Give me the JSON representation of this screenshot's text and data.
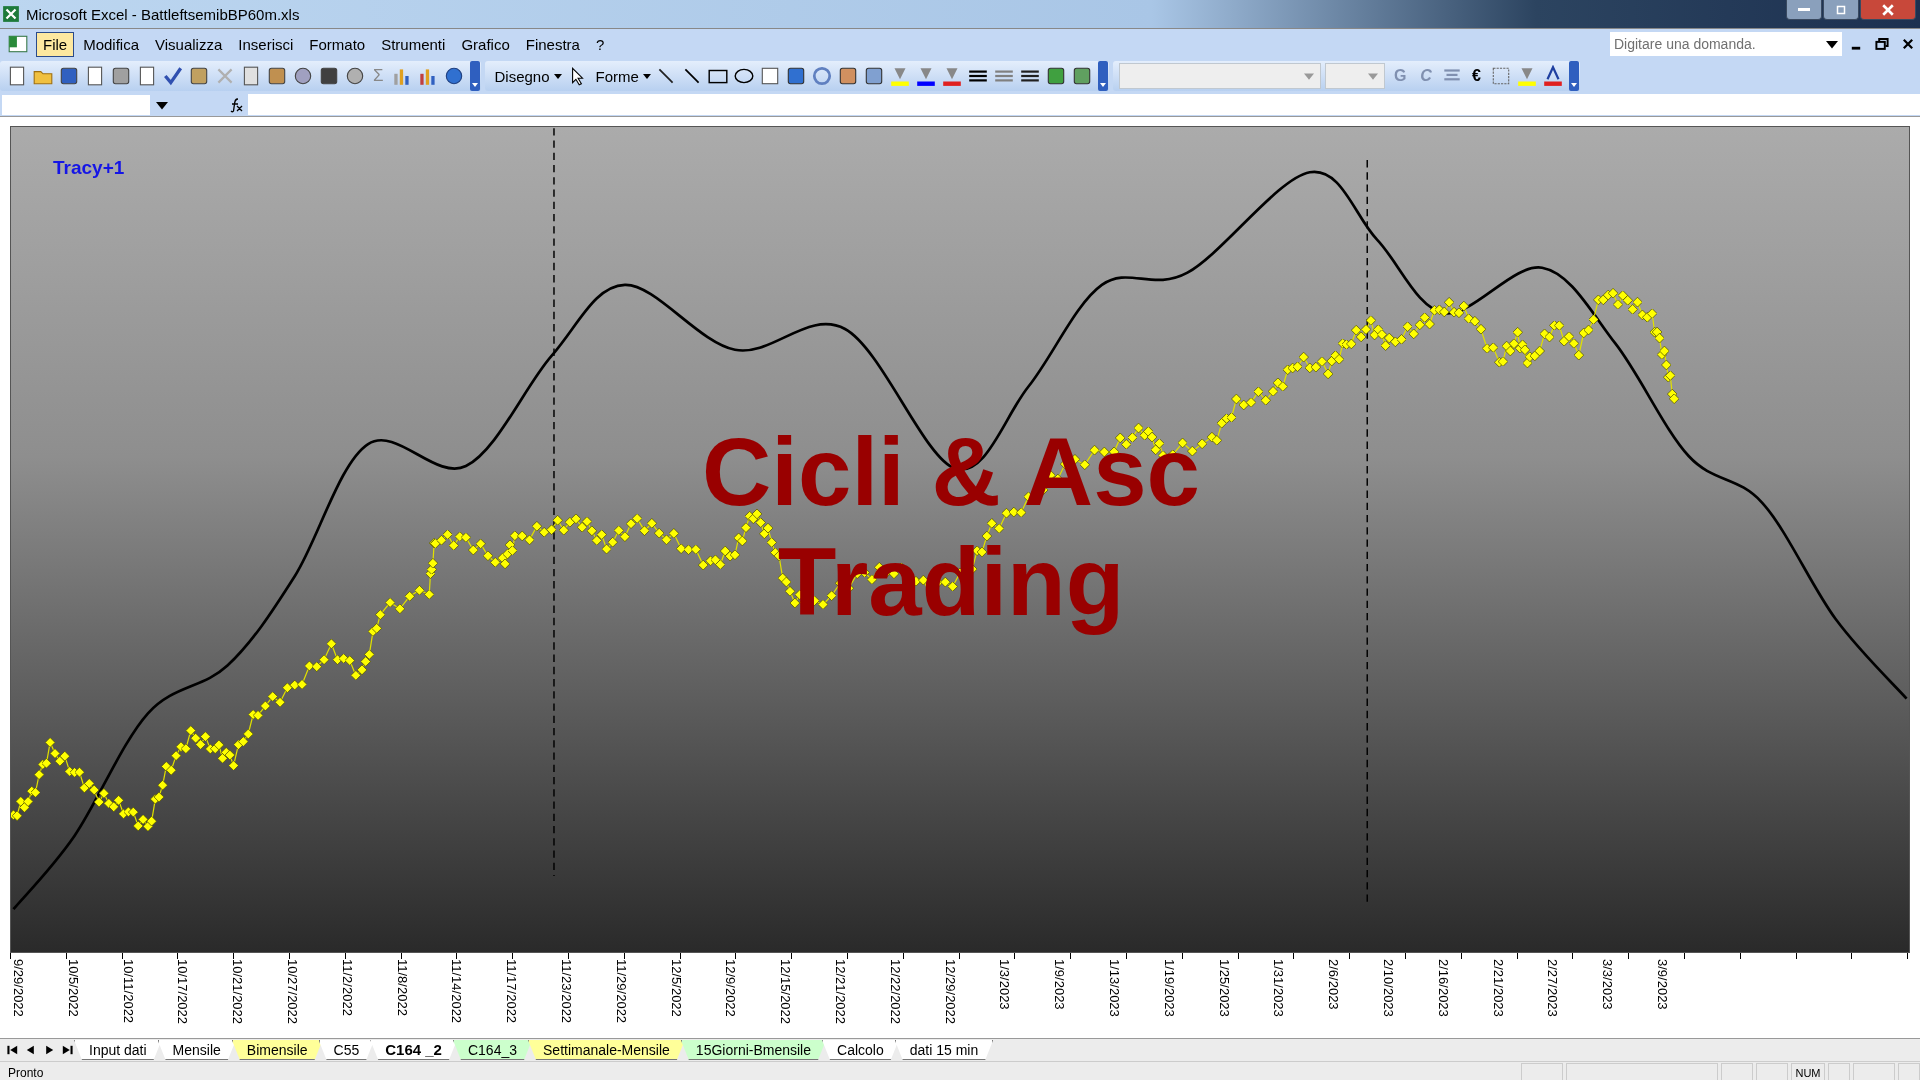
{
  "window": {
    "title": "Microsoft Excel - BattleftsemibBP60m.xls"
  },
  "menu": [
    {
      "label": "File",
      "selected": true
    },
    {
      "label": "Modifica",
      "selected": false
    },
    {
      "label": "Visualizza",
      "selected": false
    },
    {
      "label": "Inserisci",
      "selected": false
    },
    {
      "label": "Formato",
      "selected": false
    },
    {
      "label": "Strumenti",
      "selected": false
    },
    {
      "label": "Grafico",
      "selected": false
    },
    {
      "label": "Finestra",
      "selected": false
    },
    {
      "label": "?",
      "selected": false
    }
  ],
  "help_search": {
    "placeholder": "Digitare una domanda."
  },
  "toolbar": {
    "sum": "Σ",
    "drawing_menu": "Disegno",
    "shapes_menu": "Forme",
    "bold": "G",
    "italic": "C",
    "euro": "€"
  },
  "chart": {
    "series_label": "Tracy+1",
    "overlay_text": [
      "Cicli & Asc",
      "Trading"
    ],
    "x_labels": [
      "9/29/2022",
      "10/5/2022",
      "10/11/2022",
      "10/17/2022",
      "10/21/2022",
      "10/27/2022",
      "11/2/2022",
      "11/8/2022",
      "11/14/2022",
      "11/17/2022",
      "11/23/2022",
      "11/29/2022",
      "12/5/2022",
      "12/9/2022",
      "12/15/2022",
      "12/21/2022",
      "12/22/2022",
      "12/29/2022",
      "1/3/2023",
      "1/9/2023",
      "1/13/2023",
      "1/19/2023",
      "1/25/2023",
      "1/31/2023",
      "2/6/2023",
      "2/10/2023",
      "2/16/2023",
      "2/21/2023",
      "2/27/2023",
      "3/3/2023",
      "3/9/2023"
    ]
  },
  "sheet_tabs": [
    {
      "label": "Input dati",
      "selected": false,
      "color": "#ffffff"
    },
    {
      "label": "Mensile",
      "selected": false,
      "color": "#ffffff"
    },
    {
      "label": "Bimensile",
      "selected": false,
      "color": "#ffff99"
    },
    {
      "label": "C55",
      "selected": false,
      "color": "#ffffff"
    },
    {
      "label": "C164 _2",
      "selected": true,
      "color": "#ffffff"
    },
    {
      "label": "C164_3",
      "selected": false,
      "color": "#ccffcc"
    },
    {
      "label": "Settimanale-Mensile",
      "selected": false,
      "color": "#ffff99"
    },
    {
      "label": "15Giorni-Bmensile",
      "selected": false,
      "color": "#ccffcc"
    },
    {
      "label": "Calcolo",
      "selected": false,
      "color": "#ffffff"
    },
    {
      "label": "dati 15 min",
      "selected": false,
      "color": "#ffffff"
    }
  ],
  "status_bar": {
    "left": "Pronto",
    "indicator": "NUM"
  }
}
